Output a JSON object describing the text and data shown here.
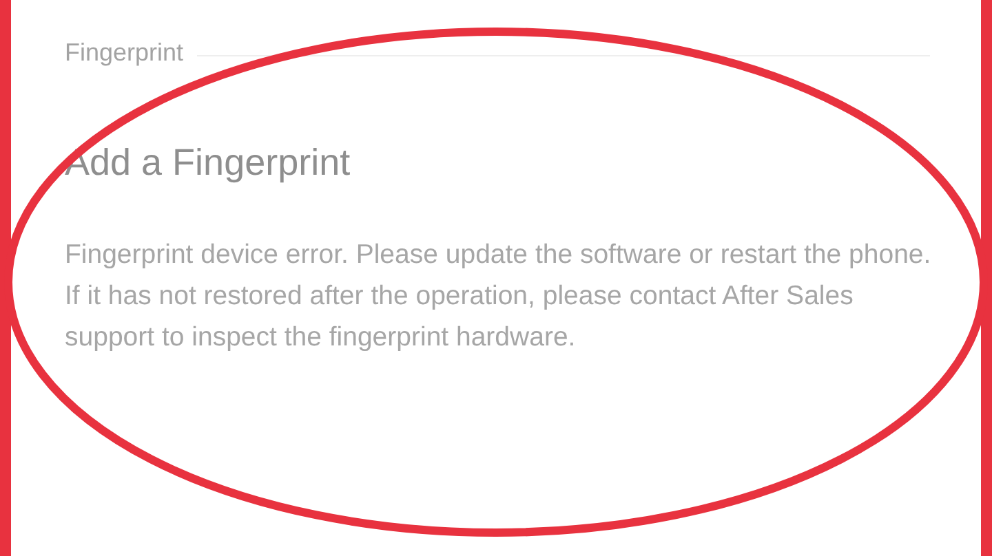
{
  "section_header": "Fingerprint",
  "dialog": {
    "title": "Add a Fingerprint",
    "message": "Fingerprint device error. Please update the software or restart the phone. If it has not restored after the operation, please contact After Sales support to inspect the fingerprint hardware."
  }
}
